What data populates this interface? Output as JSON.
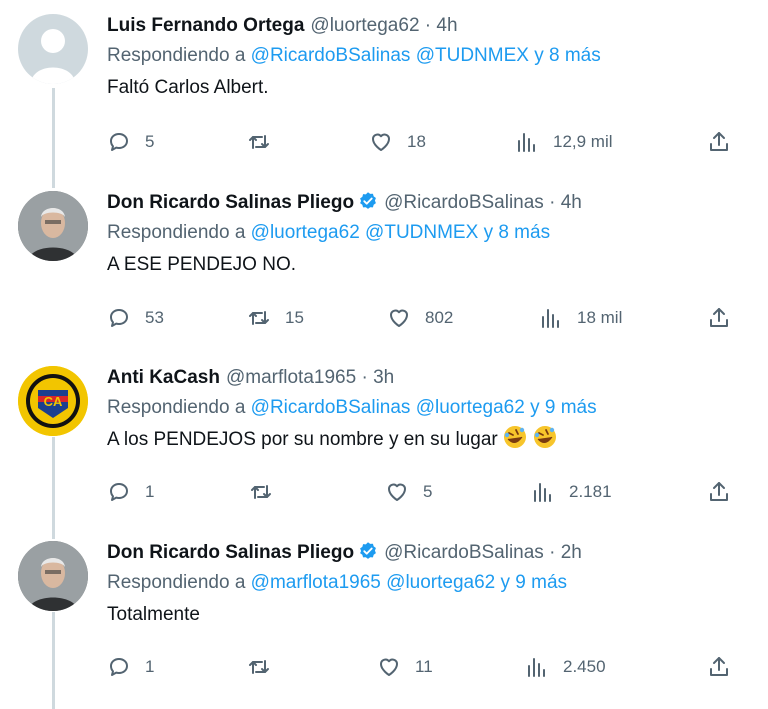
{
  "tweets": [
    {
      "display_name": "Luis Fernando Ortega",
      "verified": false,
      "handle": "@luortega62",
      "time": "4h",
      "replying_prefix": "Respondiendo a",
      "mentions": [
        "@RicardoBSalinas",
        "@TUDNMEX"
      ],
      "more": "y 8 más",
      "text": "Faltó Carlos Albert.",
      "replies": "5",
      "retweets": "",
      "likes": "18",
      "views": "12,9 mil"
    },
    {
      "display_name": "Don Ricardo Salinas Pliego",
      "verified": true,
      "handle": "@RicardoBSalinas",
      "time": "4h",
      "replying_prefix": "Respondiendo a",
      "mentions": [
        "@luortega62",
        "@TUDNMEX"
      ],
      "more": "y 8 más",
      "text": "A ESE PENDEJO NO.",
      "replies": "53",
      "retweets": "15",
      "likes": "802",
      "views": "18 mil"
    },
    {
      "display_name": "Anti KaCash",
      "verified": false,
      "handle": "@marflota1965",
      "time": "3h",
      "replying_prefix": "Respondiendo a",
      "mentions": [
        "@RicardoBSalinas",
        "@luortega62"
      ],
      "more": "y 9 más",
      "text": "A los PENDEJOS por su nombre y en su lugar",
      "replies": "1",
      "retweets": "",
      "likes": "5",
      "views": "2.181"
    },
    {
      "display_name": "Don Ricardo Salinas Pliego",
      "verified": true,
      "handle": "@RicardoBSalinas",
      "time": "2h",
      "replying_prefix": "Respondiendo a",
      "mentions": [
        "@marflota1965",
        "@luortega62"
      ],
      "more": "y 9 más",
      "text": "Totalmente",
      "replies": "1",
      "retweets": "",
      "likes": "11",
      "views": "2.450"
    }
  ],
  "separator_dot": "·",
  "colors": {
    "mention": "#1d9bf0",
    "secondary_text": "#536471",
    "verified_badge": "#1d9bf0",
    "thread_line": "#cfd9de"
  },
  "icons": {
    "reply": "reply-icon",
    "retweet": "retweet-icon",
    "like": "heart-icon",
    "views": "views-icon",
    "share": "share-icon",
    "verified": "verified-badge-icon",
    "emoji": "rolling-laughing-emoji"
  }
}
